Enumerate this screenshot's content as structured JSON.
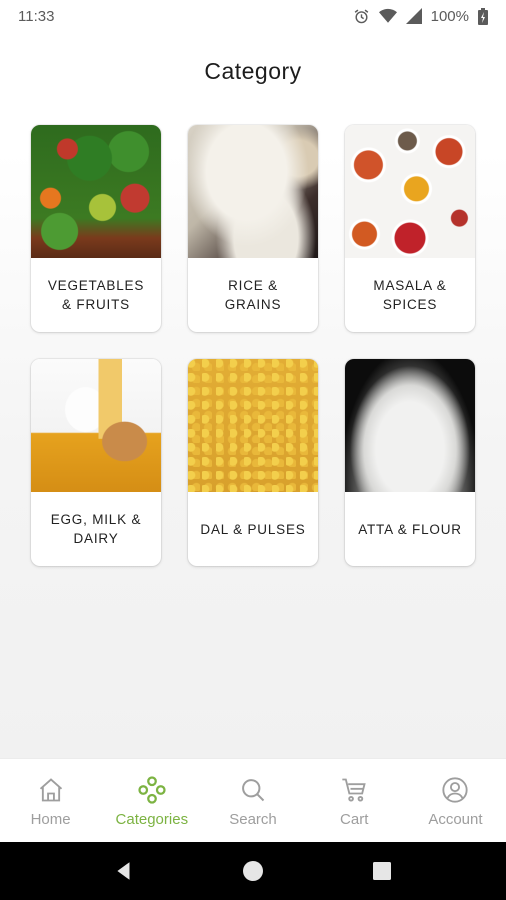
{
  "status_bar": {
    "time": "11:33",
    "battery": "100%",
    "icons": [
      "alarm-icon",
      "wifi-icon",
      "signal-icon",
      "battery-icon"
    ]
  },
  "page": {
    "title": "Category"
  },
  "categories": [
    {
      "label": "VEGETABLES & FRUITS",
      "image": "vegetables-fruits-photo"
    },
    {
      "label": "RICE & GRAINS",
      "image": "rice-grains-photo"
    },
    {
      "label": "MASALA & SPICES",
      "image": "masala-spices-photo"
    },
    {
      "label": "EGG, MILK & DAIRY",
      "image": "egg-milk-dairy-photo"
    },
    {
      "label": "DAL & PULSES",
      "image": "dal-pulses-photo"
    },
    {
      "label": "ATTA & FLOUR",
      "image": "atta-flour-photo"
    }
  ],
  "bottom_nav": {
    "active_index": 1,
    "items": [
      {
        "label": "Home",
        "icon": "home-icon"
      },
      {
        "label": "Categories",
        "icon": "categories-icon"
      },
      {
        "label": "Search",
        "icon": "search-icon"
      },
      {
        "label": "Cart",
        "icon": "cart-icon"
      },
      {
        "label": "Account",
        "icon": "account-icon"
      }
    ]
  },
  "system_nav": {
    "icons": [
      "back-icon",
      "home-circle-icon",
      "recents-icon"
    ]
  },
  "colors": {
    "accent": "#7cb342",
    "inactive": "#9e9e9e",
    "text": "#1d1d1d"
  }
}
